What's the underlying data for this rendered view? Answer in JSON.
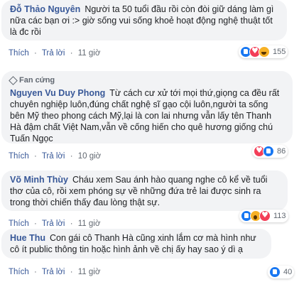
{
  "comments": [
    {
      "author": "Đỗ Thảo Nguyên",
      "text": "Người ta 50 tuổi đầu rồi còn đòi giữ dáng làm gì nữa các bạn ơi :> giờ sống vui sống khoẻ hoạt động nghệ thuật tốt là đc rồi",
      "actions": {
        "like": "Thích",
        "reply": "Trả lời",
        "time": "11 giờ"
      },
      "reactions": {
        "icons": [
          "like-icon",
          "love-icon",
          "haha-icon"
        ],
        "count": "155"
      }
    },
    {
      "badge": "Fan cứng",
      "author": "Nguyen Vu Duy Phong",
      "text": "Từ cách cư xử tới mọi thứ,giọng ca đều rất chuyên nghiệp luôn,đúng chất nghệ sĩ gạo cội luôn,người ta sống bên Mỹ theo phong cách Mỹ,lại là con lai nhưng vẫn lấy tên Thanh Hà đậm chất Việt Nam,vẫn về cống hiến cho quê hương giống chú Tuấn Ngọc",
      "actions": {
        "like": "Thích",
        "reply": "Trả lời",
        "time": "10 giờ"
      },
      "reactions": {
        "icons": [
          "love-icon",
          "like-icon"
        ],
        "count": "86"
      }
    },
    {
      "author": "Võ Minh Thùy",
      "text": "Cháu xem Sau ánh hào quang nghe cô kể về tuổi thơ của cô, rồi xem phóng sự về những đứa trẻ lai được sinh ra trong thời chiến thấy đau lòng thật sự.",
      "actions": {
        "like": "Thích",
        "reply": "Trả lời",
        "time": "11 giờ"
      },
      "reactions": {
        "icons": [
          "like-icon",
          "wow-icon",
          "love-icon"
        ],
        "count": "113"
      }
    },
    {
      "author": "Hue Thu",
      "text": "Con gái cô Thanh Hà cũng xinh lắm cơ mà hình như cô ít public thông tin hoặc hình ảnh về chị ấy hay sao ý dì ạ",
      "actions": {
        "like": "Thích",
        "reply": "Trả lời",
        "time": "11 giờ"
      },
      "reactions": {
        "icons": [
          "like-icon"
        ],
        "count": "40"
      }
    }
  ],
  "colors": {
    "author": "#385898",
    "bubble": "#f2f3f5",
    "meta": "#606770"
  }
}
